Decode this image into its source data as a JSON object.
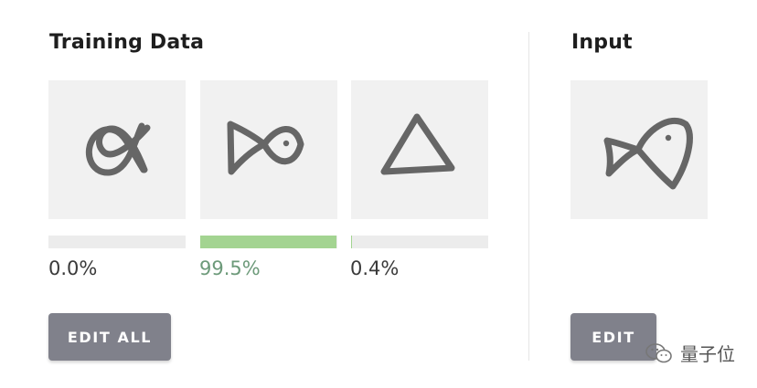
{
  "training": {
    "title": "Training Data",
    "items": [
      {
        "shape": "alpha",
        "percent_label": "0.0%",
        "confidence": 0.0
      },
      {
        "shape": "fish",
        "percent_label": "99.5%",
        "confidence": 0.995
      },
      {
        "shape": "triangle",
        "percent_label": "0.4%",
        "confidence": 0.004
      }
    ],
    "edit_all_label": "EDIT ALL"
  },
  "input": {
    "title": "Input",
    "shape": "fish",
    "edit_label": "EDIT"
  },
  "watermark": {
    "text": "量子位",
    "icon": "wechat-icon"
  },
  "colors": {
    "bar_fill": "#a3d491",
    "button": "#80818b",
    "card_bg": "#f1f1f1",
    "stroke": "#666666",
    "high_pct": "#6d9a7a"
  }
}
